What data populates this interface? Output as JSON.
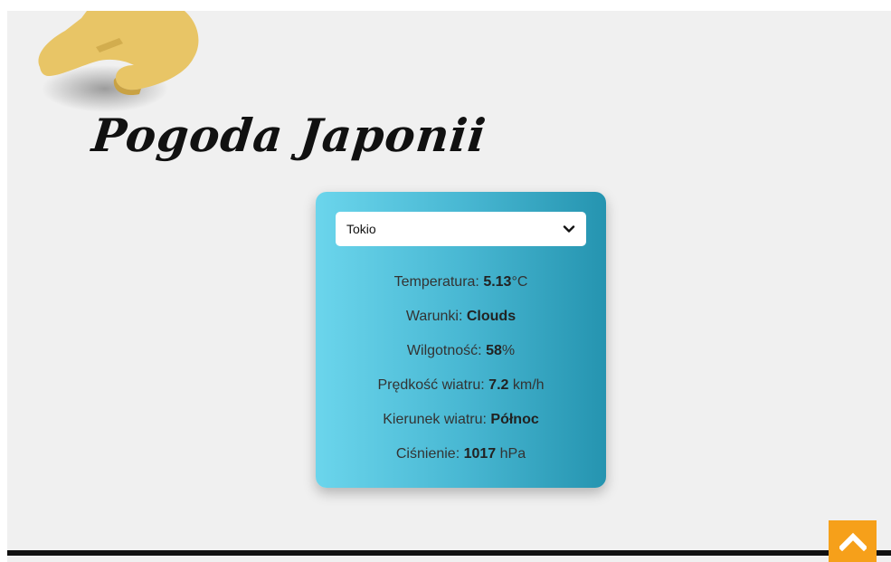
{
  "page": {
    "title": "Pogoda Japonii",
    "logo_icon": "hand-icon"
  },
  "weather": {
    "city_select": {
      "selected": "Tokio",
      "options": [
        "Tokio"
      ]
    },
    "temperature": {
      "label": "Temperatura:",
      "value": "5.13",
      "unit": "°C"
    },
    "conditions": {
      "label": "Warunki:",
      "value": "Clouds"
    },
    "humidity": {
      "label": "Wilgotność:",
      "value": "58",
      "unit": "%"
    },
    "wind_speed": {
      "label": "Prędkość wiatru:",
      "value": "7.2",
      "unit": "km/h"
    },
    "wind_direction": {
      "label": "Kierunek wiatru:",
      "value": "Północ"
    },
    "pressure": {
      "label": "Ciśnienie:",
      "value": "1017",
      "unit": "hPa"
    }
  },
  "scroll_top": {
    "icon": "chevron-up-icon"
  },
  "colors": {
    "card_gradient_start": "#6bd5ec",
    "card_gradient_end": "#2594b0",
    "scroll_button": "#f6a01a",
    "logo": "#e8c566"
  }
}
